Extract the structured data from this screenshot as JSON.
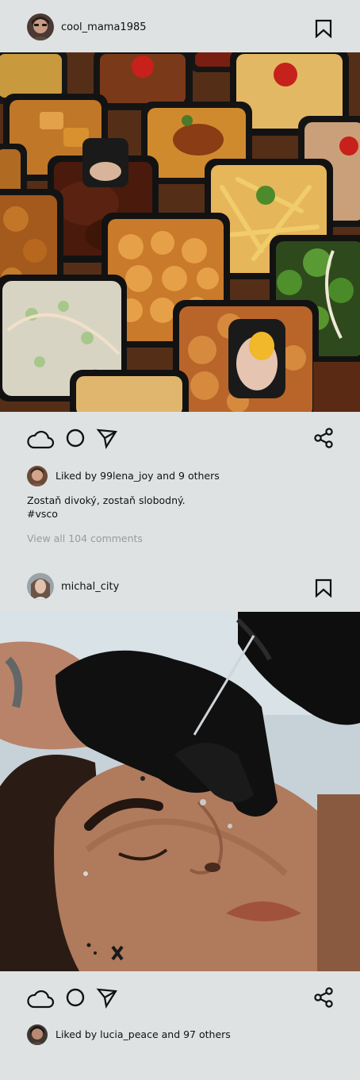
{
  "posts": [
    {
      "username": "cool_mama1985",
      "avatar": "user-avatar",
      "image": "food-boxes-photo",
      "liked_by_text": "Liked by 99lena_joy and 9 others",
      "caption_line1": "Zostaň divoký, zostaň slobodný.",
      "caption_line2": "#vsco",
      "comments_link": "View all 104 comments"
    },
    {
      "username": "michal_city",
      "avatar": "user-avatar",
      "image": "piercing-photo",
      "liked_by_text": "Liked by lucia_peace and 97 others"
    }
  ],
  "icons": {
    "bookmark": "bookmark-icon",
    "like": "cloud-icon",
    "comment": "circle-icon",
    "send": "send-icon",
    "share": "share-icon"
  },
  "colors": {
    "background": "#dfe2e2",
    "text": "#111111",
    "muted": "#9a9c9c"
  }
}
